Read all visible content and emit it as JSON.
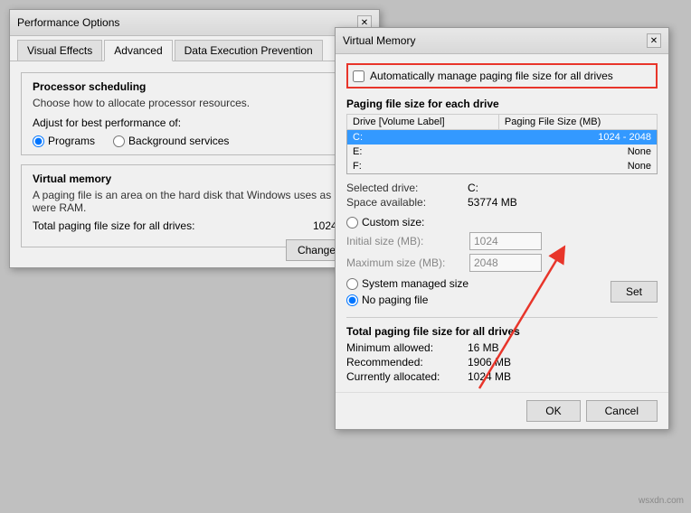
{
  "perf_window": {
    "title": "Performance Options",
    "tabs": [
      {
        "label": "Visual Effects",
        "active": false
      },
      {
        "label": "Advanced",
        "active": true
      },
      {
        "label": "Data Execution Prevention",
        "active": false
      }
    ],
    "processor": {
      "section_label": "Processor scheduling",
      "desc": "Choose how to allocate processor resources.",
      "adjust_label": "Adjust for best performance of:",
      "options": [
        "Programs",
        "Background services"
      ],
      "selected": "Programs"
    },
    "virtual_memory": {
      "section_label": "Virtual memory",
      "desc": "A paging file is an area on the hard disk that Windows uses as if it were RAM.",
      "total_label": "Total paging file size for all drives:",
      "total_value": "1024 MB",
      "change_btn": "Change..."
    }
  },
  "vm_window": {
    "title": "Virtual Memory",
    "auto_manage": {
      "label": "Automatically manage paging file size for all drives",
      "checked": false
    },
    "paging_label": "Paging file size for each drive",
    "table_headers": {
      "drive": "Drive  [Volume Label]",
      "size": "Paging File Size (MB)"
    },
    "drives": [
      {
        "letter": "C:",
        "label": "",
        "size": "1024 - 2048",
        "selected": true
      },
      {
        "letter": "E:",
        "label": "",
        "size": "None",
        "selected": false
      },
      {
        "letter": "F:",
        "label": "",
        "size": "None",
        "selected": false
      }
    ],
    "selected_drive_label": "Selected drive:",
    "selected_drive_value": "C:",
    "space_available_label": "Space available:",
    "space_available_value": "53774 MB",
    "custom_size_label": "Custom size:",
    "initial_size_label": "Initial size (MB):",
    "initial_size_value": "1024",
    "max_size_label": "Maximum size (MB):",
    "max_size_value": "2048",
    "system_managed_label": "System managed size",
    "no_paging_label": "No paging file",
    "set_btn": "Set",
    "total_section_label": "Total paging file size for all drives",
    "min_allowed_label": "Minimum allowed:",
    "min_allowed_value": "16 MB",
    "recommended_label": "Recommended:",
    "recommended_value": "1906 MB",
    "currently_allocated_label": "Currently allocated:",
    "currently_allocated_value": "1024 MB",
    "ok_btn": "OK",
    "cancel_btn": "Cancel"
  },
  "watermark": "wsxdn.com"
}
